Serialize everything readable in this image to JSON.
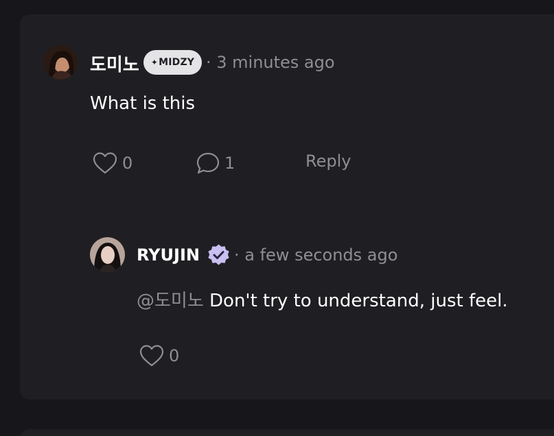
{
  "comment": {
    "author": "도미노",
    "badge_label": "MIDZY",
    "badge_icon": "sparkle-icon",
    "time": "· 3 minutes ago",
    "text": "What is this",
    "like_count": "0",
    "reply_count": "1",
    "reply_label": "Reply"
  },
  "reply": {
    "author": "RYUJIN",
    "verified_icon": "verified-badge-icon",
    "time": "· a few seconds ago",
    "mention": "@도미노",
    "text": " Don't try to understand, just feel.",
    "like_count": "0"
  },
  "colors": {
    "background": "#17171b",
    "card": "#1f1f23",
    "muted_text": "#8e8e93",
    "verified": "#c9bff0"
  }
}
